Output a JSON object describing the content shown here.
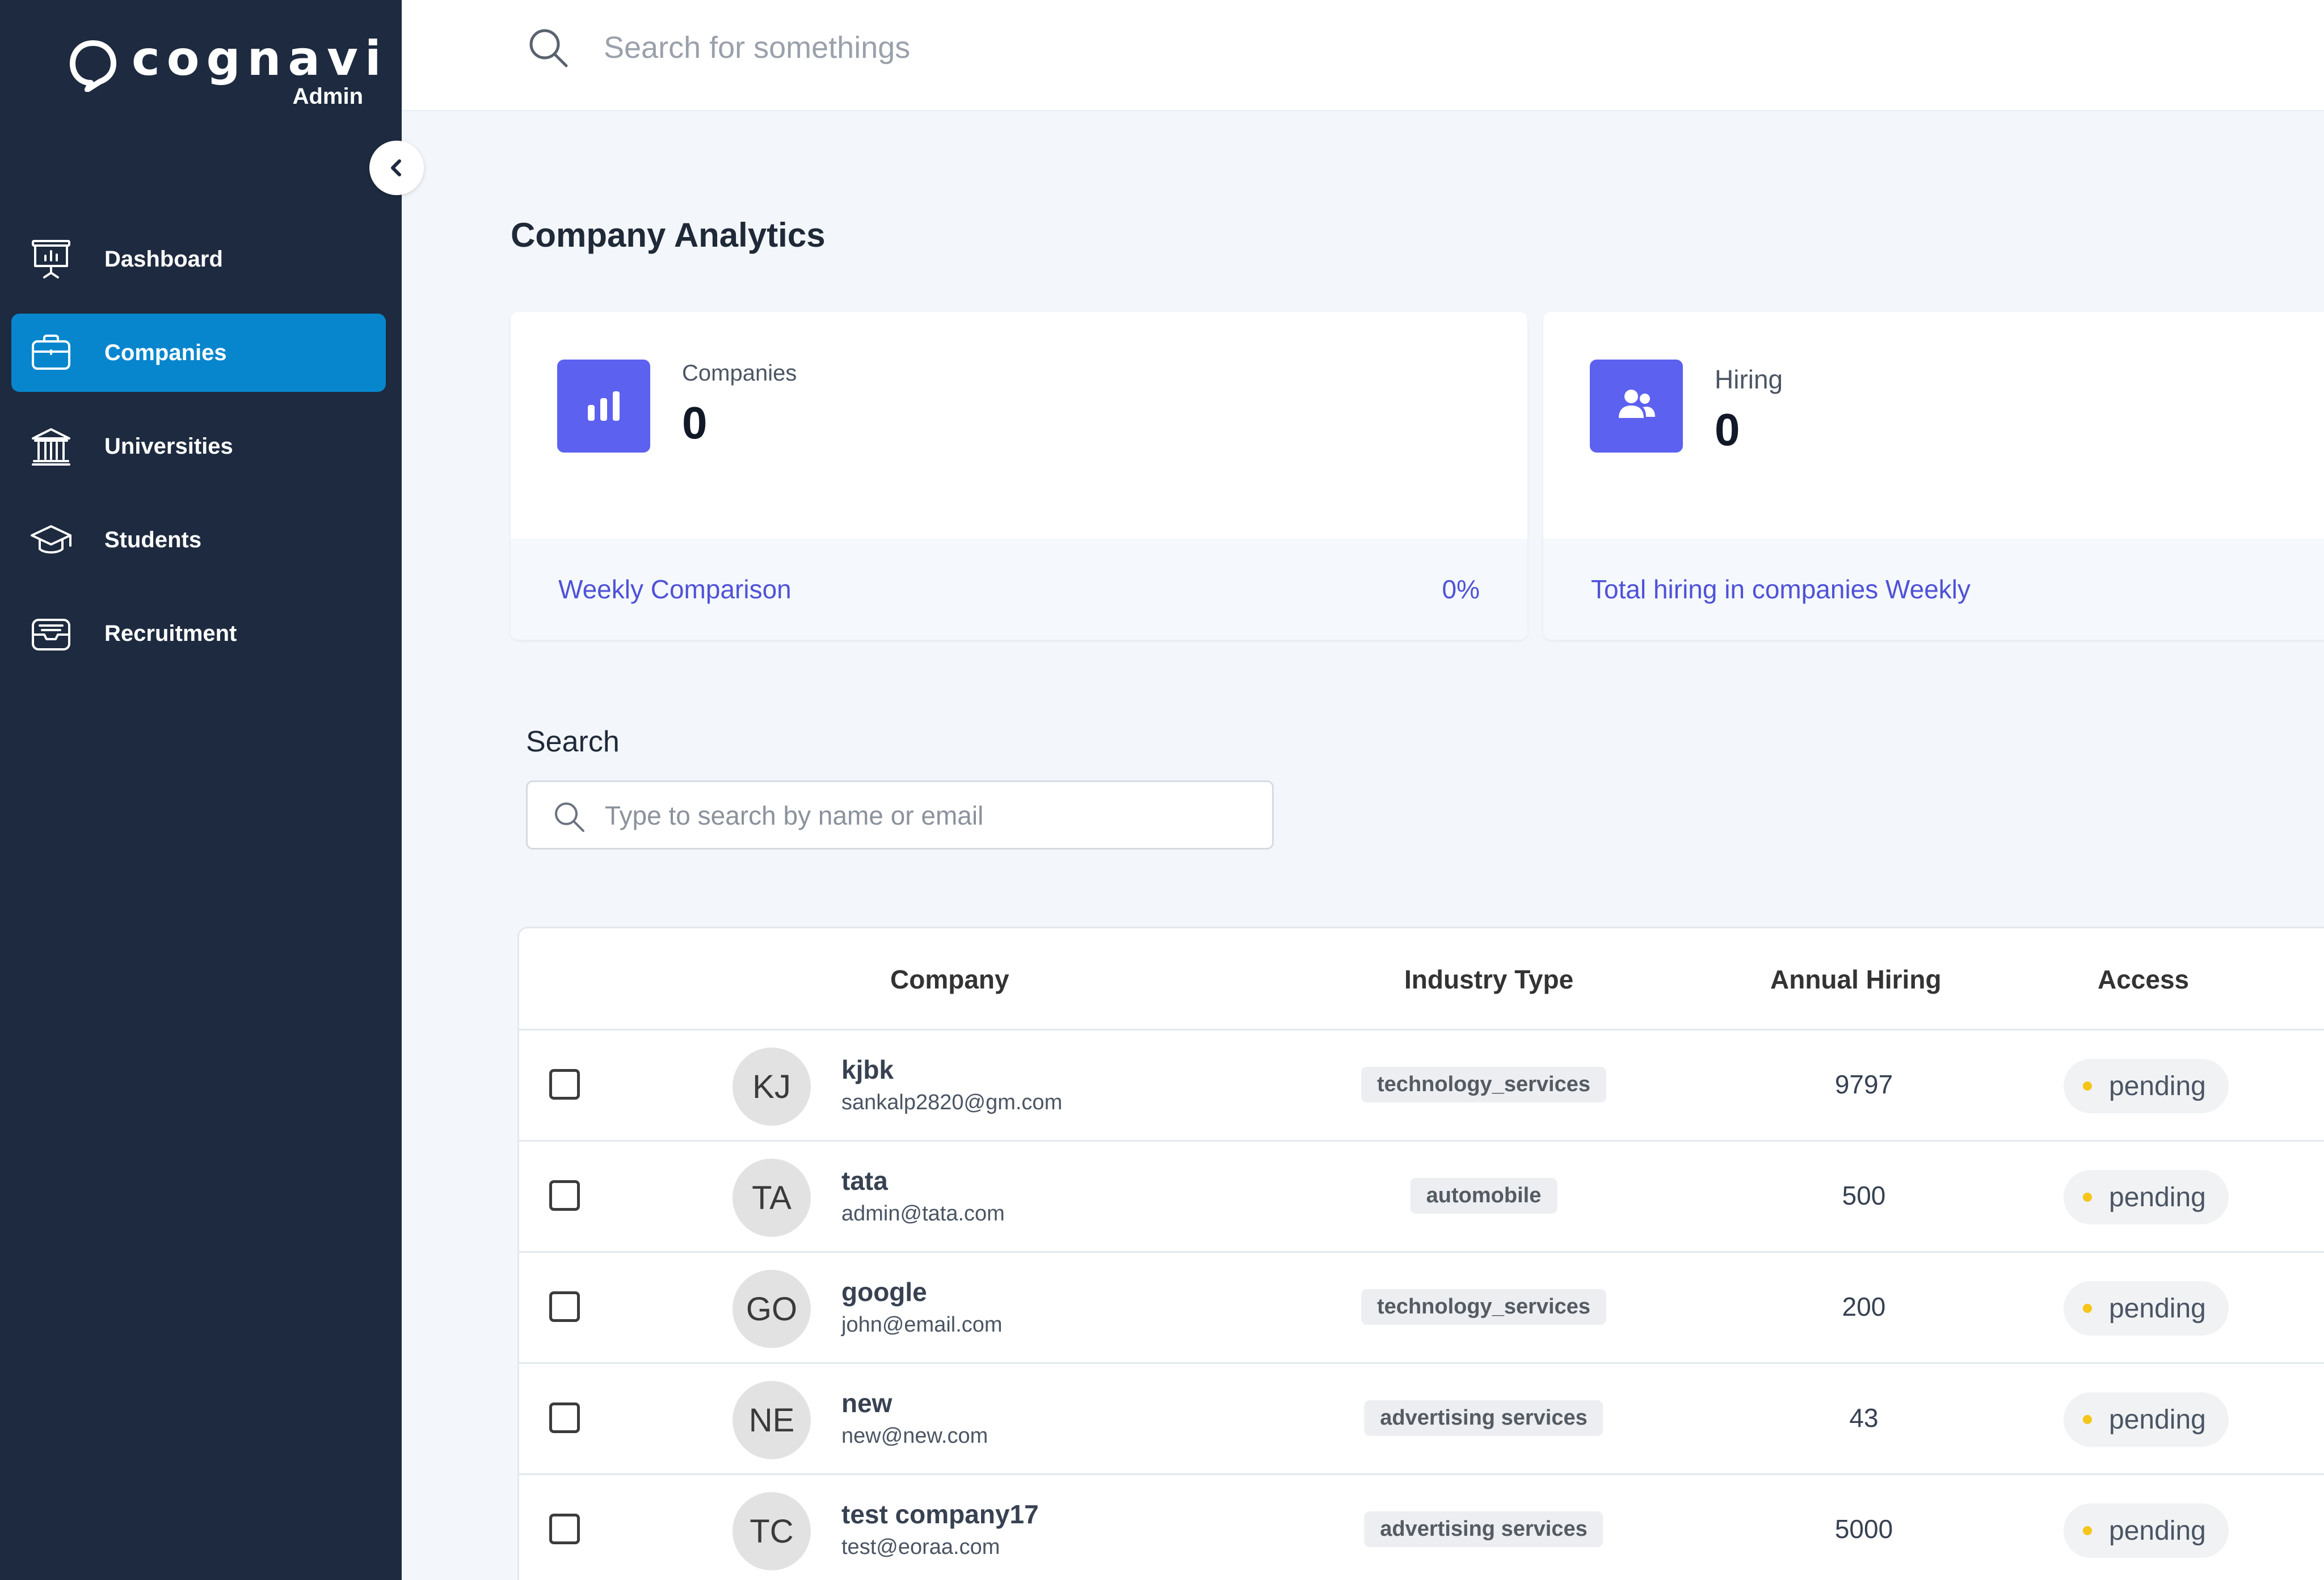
{
  "brand": {
    "name": "cognavi",
    "subtitle": "Admin"
  },
  "sidebar": {
    "items": [
      {
        "label": "Dashboard",
        "icon": "presentation-chart-icon",
        "active": false
      },
      {
        "label": "Companies",
        "icon": "briefcase-icon",
        "active": true
      },
      {
        "label": "Universities",
        "icon": "institution-icon",
        "active": false
      },
      {
        "label": "Students",
        "icon": "graduation-cap-icon",
        "active": false
      },
      {
        "label": "Recruitment",
        "icon": "inbox-tray-icon",
        "active": false
      }
    ]
  },
  "topbar": {
    "search_placeholder": "Search for somethings"
  },
  "page": {
    "title": "Company Analytics"
  },
  "cards": [
    {
      "label": "Companies",
      "value": "0",
      "footer_text": "Weekly Comparison",
      "footer_pct": "0%",
      "icon": "bar-chart-icon",
      "accent": "#5c61f0"
    },
    {
      "label": "Hiring",
      "value": "0",
      "footer_text": "Total hiring in companies Weekly",
      "icon": "users-icon",
      "accent": "#5c61f0"
    }
  ],
  "search": {
    "label": "Search",
    "placeholder": "Type to search by name or email"
  },
  "table": {
    "headers": {
      "company": "Company",
      "industry": "Industry Type",
      "hiring": "Annual Hiring",
      "access": "Access"
    },
    "rows": [
      {
        "initials": "KJ",
        "name": "kjbk",
        "email": "sankalp2820@gm.com",
        "industry": "technology_services",
        "hiring": "9797",
        "access": "pending"
      },
      {
        "initials": "TA",
        "name": "tata",
        "email": "admin@tata.com",
        "industry": "automobile",
        "hiring": "500",
        "access": "pending"
      },
      {
        "initials": "GO",
        "name": "google",
        "email": "john@email.com",
        "industry": "technology_services",
        "hiring": "200",
        "access": "pending"
      },
      {
        "initials": "NE",
        "name": "new",
        "email": "new@new.com",
        "industry": "advertising services",
        "hiring": "43",
        "access": "pending"
      },
      {
        "initials": "TC",
        "name": "test company17",
        "email": "test@eoraa.com",
        "industry": "advertising services",
        "hiring": "5000",
        "access": "pending"
      }
    ]
  },
  "colors": {
    "sidebar_bg": "#1d2a3f",
    "active_nav": "#0786ce",
    "accent": "#5c61f0",
    "status_pending": "#f5c518"
  }
}
